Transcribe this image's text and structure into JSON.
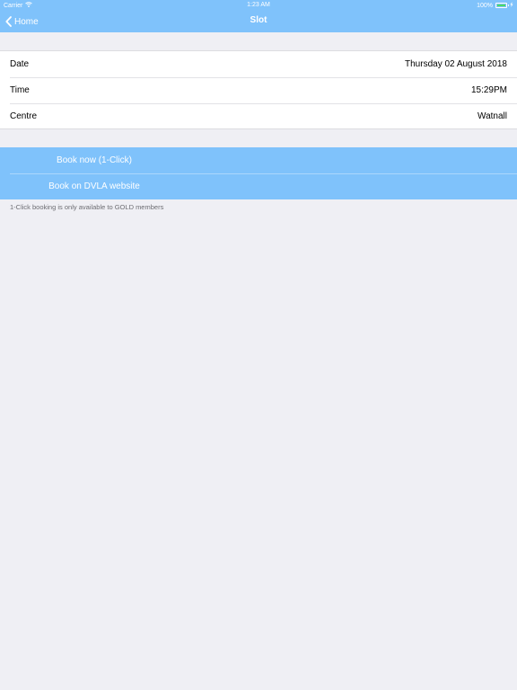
{
  "status_bar": {
    "carrier": "Carrier",
    "time": "1:23 AM",
    "battery_percent": "100%",
    "battery_level": 1.0,
    "wifi_icon": "wifi-icon",
    "battery_icon": "battery-icon",
    "charging_icon": "charging-icon"
  },
  "nav": {
    "back_label": "Home",
    "back_icon": "chevron-left-icon",
    "title": "Slot"
  },
  "details": {
    "rows": [
      {
        "label": "Date",
        "value": "Thursday 02 August 2018"
      },
      {
        "label": "Time",
        "value": "15:29PM"
      },
      {
        "label": "Centre",
        "value": "Watnall"
      }
    ]
  },
  "actions": {
    "book_now": "Book now (1-Click)",
    "book_dvla": "Book on DVLA website"
  },
  "footnote": "1-Click booking is only available to GOLD members",
  "colors": {
    "accent": "#7fc2fb",
    "background": "#efeff4",
    "footnote": "#6d6d72"
  }
}
